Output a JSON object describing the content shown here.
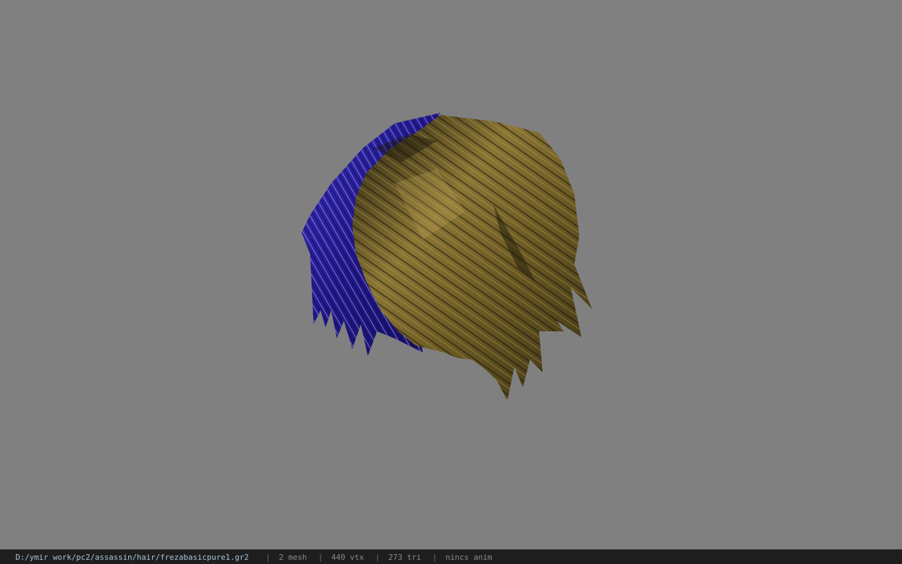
{
  "viewer": {
    "background_color": "#808080",
    "model": {
      "name": "hair mesh",
      "primary_color": "#8a7230",
      "secondary_color": "#2a1f9a"
    }
  },
  "status_bar": {
    "file_path": "D:/ymir work/pc2/assassin/hair/frezabasicpure1.gr2",
    "separator": "|",
    "mesh": "2 mesh",
    "vertices": "440 vtx",
    "triangles": "273 tri",
    "animation": "nincs anim"
  }
}
